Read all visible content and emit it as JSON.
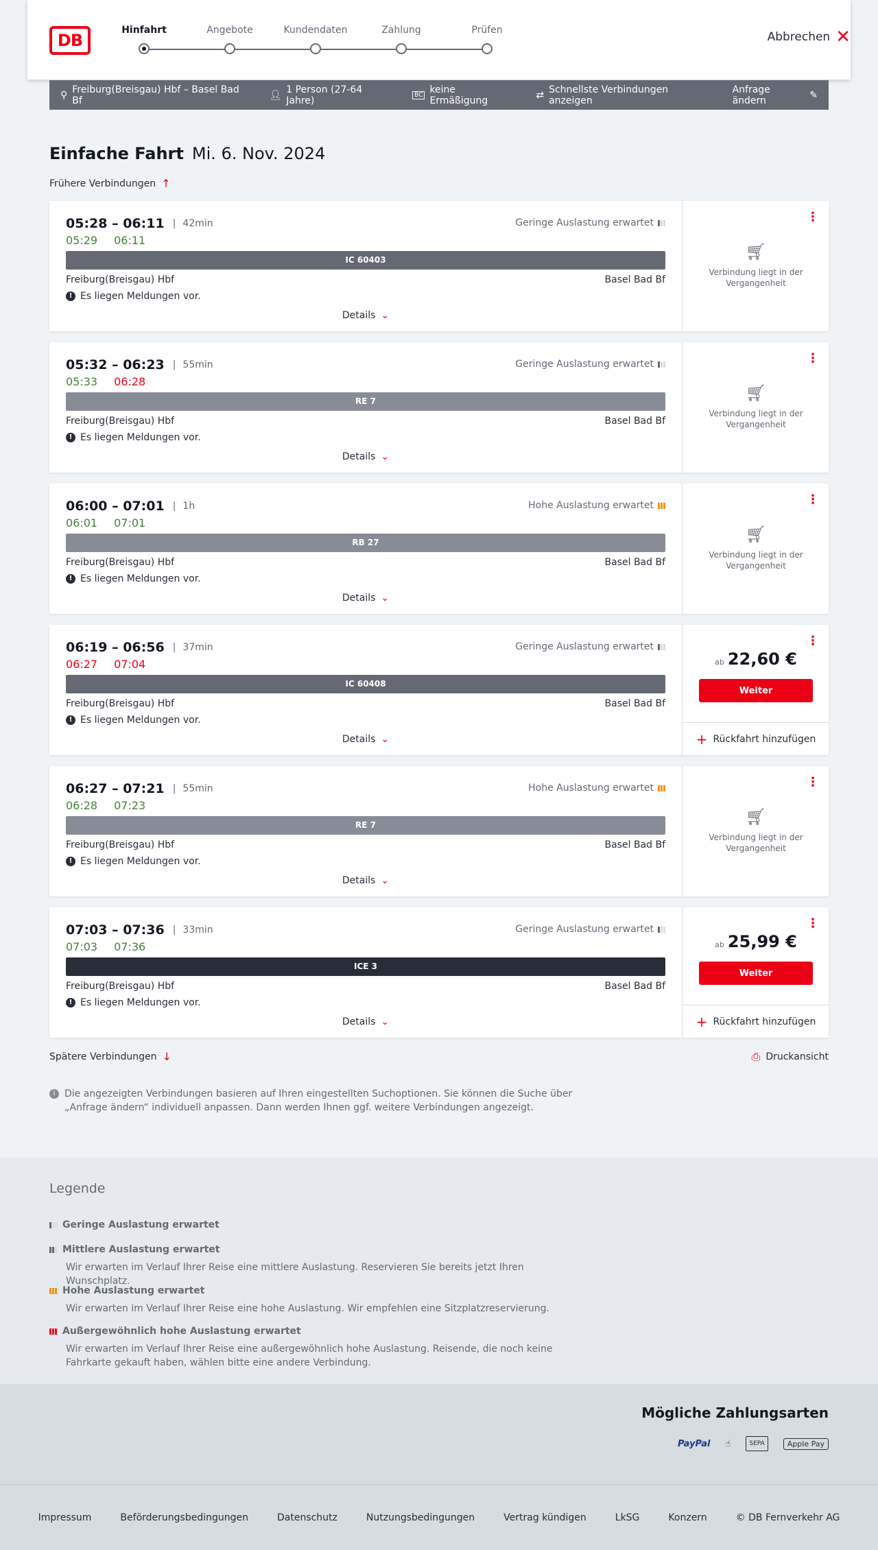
{
  "header": {
    "logo": "DB",
    "steps": [
      "Hinfahrt",
      "Angebote",
      "Kundendaten",
      "Zahlung",
      "Prüfen"
    ],
    "active_step": 0,
    "cancel_label": "Abbrechen"
  },
  "searchbar": {
    "route": "Freiburg(Breisgau) Hbf – Basel Bad Bf",
    "persons": "1 Person (27-64 Jahre)",
    "discount": "keine Ermäßigung",
    "fastest": "Schnellste Verbindungen anzeigen",
    "change_label": "Anfrage ändern"
  },
  "page": {
    "title": "Einfache Fahrt",
    "date": "Mi. 6. Nov. 2024",
    "earlier_label": "Frühere Verbindungen",
    "later_label": "Spätere Verbindungen",
    "print_label": "Druckansicht",
    "info_text": "Die angezeigten Verbindungen basieren auf Ihren eingestellten Suchoptionen. Sie können die Suche über „Anfrage ändern“ individuell anpassen. Dann werden Ihnen ggf. weitere Verbindungen angezeigt."
  },
  "connections": [
    {
      "times": "05:28 – 06:11",
      "duration": "42min",
      "rt_dep": "05:29",
      "rt_arr": "06:11",
      "dep_status": "green",
      "arr_status": "green",
      "occupancy": "Geringe Auslastung erwartet",
      "occ_level": "low",
      "train": "IC 60403",
      "train_color": "#646973",
      "from": "Freiburg(Breisgau) Hbf",
      "to": "Basel Bad Bf",
      "message": "Es liegen Meldungen vor.",
      "details": "Details",
      "past": true,
      "past_text": "Verbindung liegt in der Vergangenheit"
    },
    {
      "times": "05:32 – 06:23",
      "duration": "55min",
      "rt_dep": "05:33",
      "rt_arr": "06:28",
      "dep_status": "green",
      "arr_status": "red",
      "occupancy": "Geringe Auslastung erwartet",
      "occ_level": "low",
      "train": "RE 7",
      "train_color": "#878c96",
      "from": "Freiburg(Breisgau) Hbf",
      "to": "Basel Bad Bf",
      "message": "Es liegen Meldungen vor.",
      "details": "Details",
      "past": true,
      "past_text": "Verbindung liegt in der Vergangenheit"
    },
    {
      "times": "06:00 – 07:01",
      "duration": "1h",
      "rt_dep": "06:01",
      "rt_arr": "07:01",
      "dep_status": "green",
      "arr_status": "green",
      "occupancy": "Hohe Auslastung erwartet",
      "occ_level": "high",
      "train": "RB 27",
      "train_color": "#878c96",
      "from": "Freiburg(Breisgau) Hbf",
      "to": "Basel Bad Bf",
      "message": "Es liegen Meldungen vor.",
      "details": "Details",
      "past": true,
      "past_text": "Verbindung liegt in der Vergangenheit"
    },
    {
      "times": "06:19 – 06:56",
      "duration": "37min",
      "rt_dep": "06:27",
      "rt_arr": "07:04",
      "dep_status": "red",
      "arr_status": "red",
      "occupancy": "Geringe Auslastung erwartet",
      "occ_level": "low",
      "train": "IC 60408",
      "train_color": "#646973",
      "from": "Freiburg(Breisgau) Hbf",
      "to": "Basel Bad Bf",
      "message": "Es liegen Meldungen vor.",
      "details": "Details",
      "past": false,
      "price_prefix": "ab",
      "price": "22,60 €",
      "button": "Weiter",
      "return_label": "Rückfahrt hinzufügen"
    },
    {
      "times": "06:27 – 07:21",
      "duration": "55min",
      "rt_dep": "06:28",
      "rt_arr": "07:23",
      "dep_status": "green",
      "arr_status": "green",
      "occupancy": "Hohe Auslastung erwartet",
      "occ_level": "high",
      "train": "RE 7",
      "train_color": "#878c96",
      "from": "Freiburg(Breisgau) Hbf",
      "to": "Basel Bad Bf",
      "message": "Es liegen Meldungen vor.",
      "details": "Details",
      "past": true,
      "past_text": "Verbindung liegt in der Vergangenheit"
    },
    {
      "times": "07:03 – 07:36",
      "duration": "33min",
      "rt_dep": "07:03",
      "rt_arr": "07:36",
      "dep_status": "green",
      "arr_status": "green",
      "occupancy": "Geringe Auslastung erwartet",
      "occ_level": "low",
      "train": "ICE 3",
      "train_color": "#282d37",
      "from": "Freiburg(Breisgau) Hbf",
      "to": "Basel Bad Bf",
      "message": "Es liegen Meldungen vor.",
      "details": "Details",
      "past": false,
      "price_prefix": "ab",
      "price": "25,99 €",
      "button": "Weiter",
      "return_label": "Rückfahrt hinzufügen"
    }
  ],
  "legend": {
    "title": "Legende",
    "items": [
      {
        "level": "low",
        "title": "Geringe Auslastung erwartet",
        "text": ""
      },
      {
        "level": "mid",
        "title": "Mittlere Auslastung erwartet",
        "text": "Wir erwarten im Verlauf Ihrer Reise eine mittlere Auslastung. Reservieren Sie bereits jetzt Ihren Wunschplatz."
      },
      {
        "level": "high",
        "title": "Hohe Auslastung erwartet",
        "text": "Wir erwarten im Verlauf Ihrer Reise eine hohe Auslastung. Wir empfehlen eine Sitzplatzreservierung."
      },
      {
        "level": "ext",
        "title": "Außergewöhnlich hohe Auslastung erwartet",
        "text": "Wir erwarten im Verlauf Ihrer Reise eine außergewöhnlich hohe Auslastung. Reisende, die noch keine Fahrkarte gekauft haben, wählen bitte eine andere Verbindung."
      }
    ]
  },
  "payment": {
    "title": "Mögliche Zahlungsarten",
    "methods": [
      "PayPal",
      "SEPA",
      "Apple Pay"
    ]
  },
  "footer": {
    "links": [
      "Impressum",
      "Beförderungsbedingungen",
      "Datenschutz",
      "Nutzungsbedingungen",
      "Vertrag kündigen",
      "LkSG",
      "Konzern",
      "© DB Fernverkehr AG"
    ]
  }
}
